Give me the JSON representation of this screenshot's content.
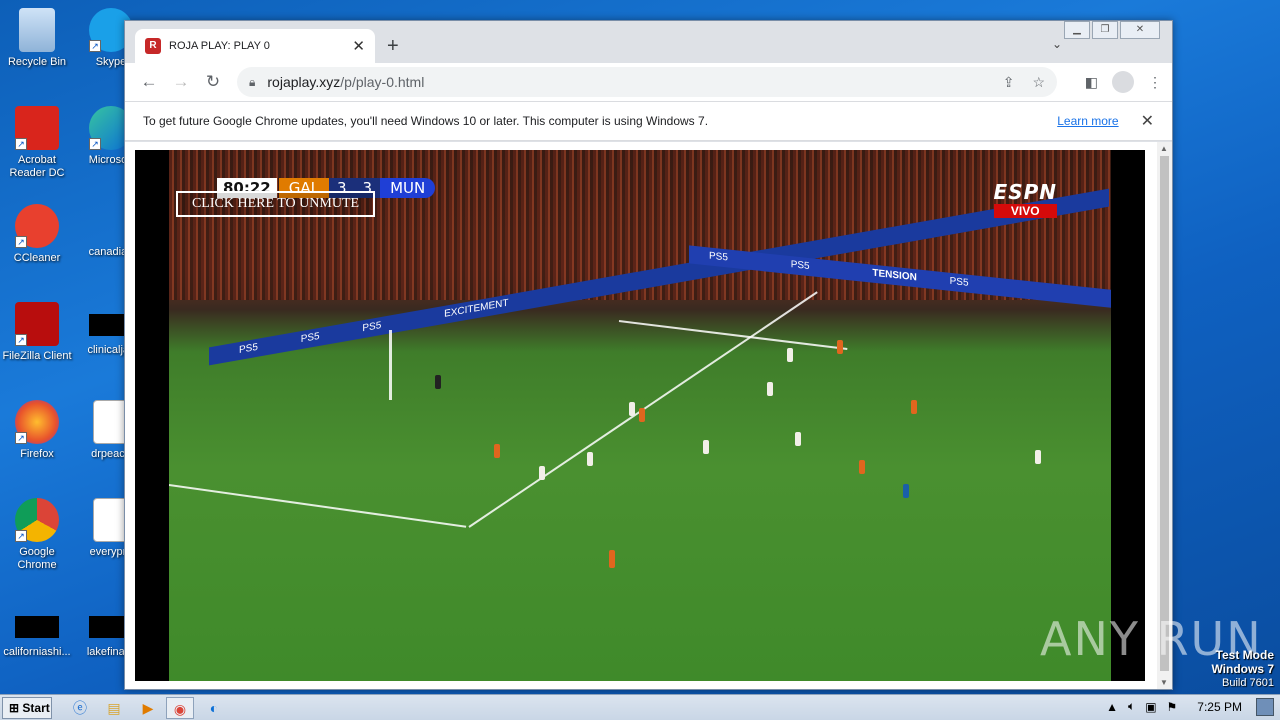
{
  "desktop": {
    "icons": [
      {
        "label": "Recycle Bin"
      },
      {
        "label": "Skype"
      },
      {
        "label": "Acrobat Reader DC"
      },
      {
        "label": "Microsoft"
      },
      {
        "label": "CCleaner"
      },
      {
        "label": "canadian"
      },
      {
        "label": "FileZilla Client"
      },
      {
        "label": "clinicaljac"
      },
      {
        "label": "Firefox"
      },
      {
        "label": "drpeace"
      },
      {
        "label": "Google Chrome"
      },
      {
        "label": "everypre"
      },
      {
        "label": "californiashi..."
      },
      {
        "label": "lakefinally"
      }
    ]
  },
  "browser": {
    "tab": {
      "title": "ROJA PLAY: PLAY 0",
      "favicon": "R"
    },
    "url_host": "rojaplay.xyz",
    "url_path": "/p/play-0.html",
    "infobar": {
      "message": "To get future Google Chrome updates, you'll need Windows 10 or later. This computer is using Windows 7.",
      "link": "Learn more"
    }
  },
  "video": {
    "clock": "80:22",
    "home_team": "GAL",
    "home_score": "3",
    "away_score": "3",
    "away_team": "MUN",
    "unmute_label": "CLICK HERE TO UNMUTE",
    "broadcaster": "ESPN",
    "live_label": "VIVO",
    "board_texts": [
      "PS5",
      "EXCITEMENT",
      "TENSION"
    ]
  },
  "watermark": "ANY RUN",
  "os": {
    "test_mode": "Test Mode",
    "windows": "Windows 7",
    "build": "Build 7601",
    "start_label": "Start",
    "time": "7:25 PM"
  }
}
